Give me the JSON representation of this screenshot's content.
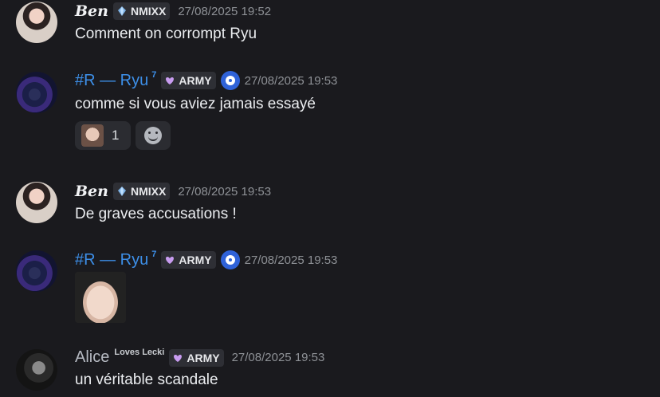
{
  "messages": [
    {
      "author": "Ben",
      "tag": "NMIXX",
      "timestamp": "27/08/2025 19:52",
      "text": "Comment on corrompt Ryu"
    },
    {
      "author": "#R — Ryu",
      "author_sup": "7",
      "tag": "ARMY",
      "timestamp": "27/08/2025 19:53",
      "text": "comme si vous aviez jamais essayé",
      "reaction_count": "1"
    },
    {
      "author": "Ben",
      "tag": "NMIXX",
      "timestamp": "27/08/2025 19:53",
      "text": "De graves accusations !"
    },
    {
      "author": "#R — Ryu",
      "author_sup": "7",
      "tag": "ARMY",
      "timestamp": "27/08/2025 19:53"
    },
    {
      "author": "Alice",
      "author_sup": "Loves Lecki",
      "tag": "ARMY",
      "timestamp": "27/08/2025 19:53",
      "text": "un véritable scandale"
    }
  ],
  "colors": {
    "background": "#1a1a1e",
    "ryu_name": "#3d8fe8",
    "verified_badge": "#2f62d8"
  },
  "icons": [
    "nmixx-gem-icon",
    "army-heart-icon",
    "verified-icon",
    "add-reaction-icon"
  ]
}
